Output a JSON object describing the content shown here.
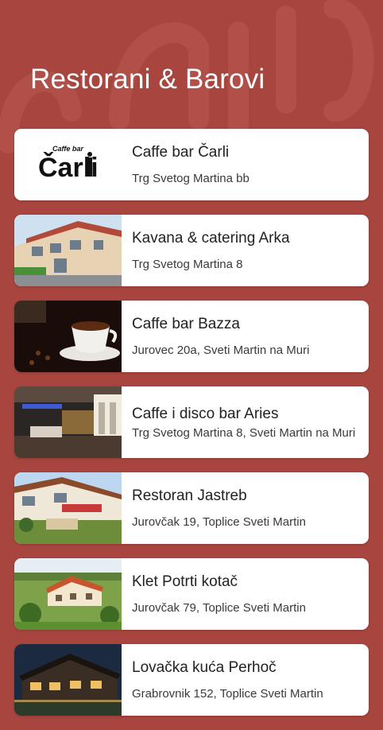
{
  "page": {
    "title": "Restorani & Barovi"
  },
  "colors": {
    "background": "#a8453e",
    "card": "#ffffff",
    "text": "#222222"
  },
  "places": [
    {
      "name": "Caffe bar Čarli",
      "address": "Trg Svetog Martina bb",
      "thumbnail": "carli-logo",
      "logo_text": "Čarli",
      "logo_small": "Caffe bar"
    },
    {
      "name": "Kavana & catering Arka",
      "address": "Trg Svetog Martina 8",
      "thumbnail": "arka-building-photo"
    },
    {
      "name": "Caffe bar Bazza",
      "address": "Jurovec 20a, Sveti Martin na Muri",
      "thumbnail": "coffee-cup-photo"
    },
    {
      "name": "Caffe i disco bar Aries",
      "address": "Trg Svetog Martina 8, Sveti Martin na Muri",
      "thumbnail": "bar-interior-photo"
    },
    {
      "name": "Restoran Jastreb",
      "address": "Jurovčak 19, Toplice Sveti Martin",
      "thumbnail": "restaurant-terrace-photo"
    },
    {
      "name": "Klet Potrti kotač",
      "address": "Jurovčak 79, Toplice Sveti Martin",
      "thumbnail": "countryside-house-photo"
    },
    {
      "name": "Lovačka kuća Perhoč",
      "address": "Grabrovnik 152, Toplice Sveti Martin",
      "thumbnail": "lodge-night-photo"
    }
  ]
}
